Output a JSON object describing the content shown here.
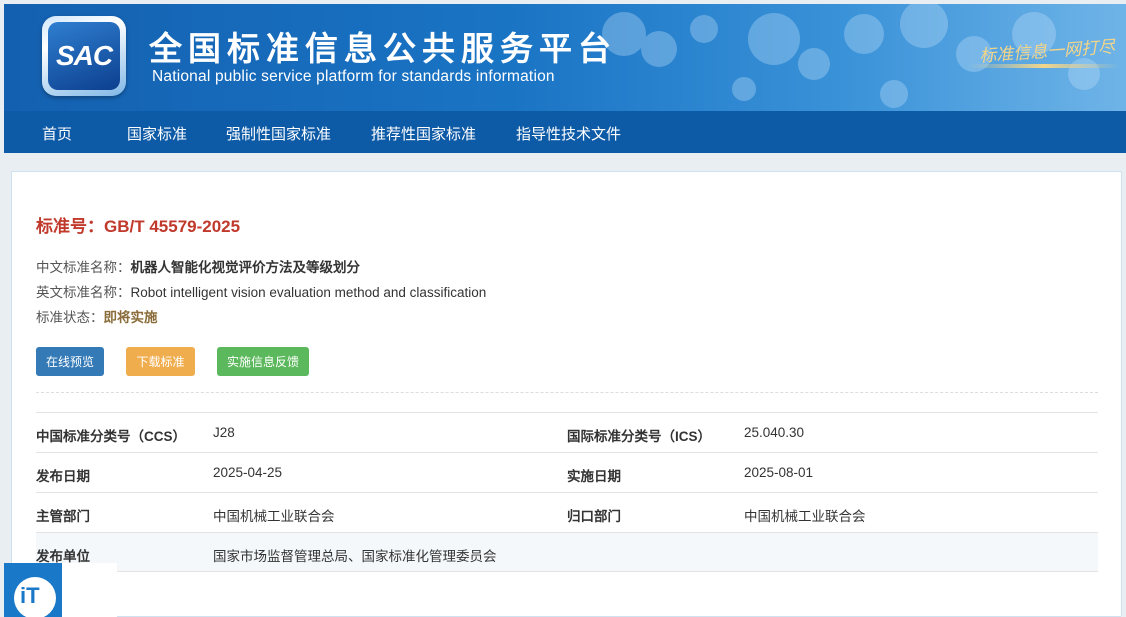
{
  "header": {
    "logo_text": "SAC",
    "title_cn": "全国标准信息公共服务平台",
    "title_en": "National public service platform  for standards information",
    "slogan": "标准信息一网打尽"
  },
  "nav": {
    "items": [
      {
        "label": "首页"
      },
      {
        "label": "国家标准"
      },
      {
        "label": "强制性国家标准"
      },
      {
        "label": "推荐性国家标准"
      },
      {
        "label": "指导性技术文件"
      }
    ]
  },
  "standard": {
    "number_label": "标准号：",
    "number": "GB/T 45579-2025",
    "cn_name_label": "中文标准名称：",
    "cn_name": "机器人智能化视觉评价方法及等级划分",
    "en_name_label": "英文标准名称：",
    "en_name": "Robot intelligent vision evaluation method and classification",
    "status_label": "标准状态：",
    "status": "即将实施"
  },
  "actions": {
    "preview": "在线预览",
    "download": "下载标准",
    "feedback": "实施信息反馈"
  },
  "details": {
    "rows": [
      {
        "k1": "中国标准分类号（CCS）",
        "v1": "J28",
        "k2": "国际标准分类号（ICS）",
        "v2": "25.040.30"
      },
      {
        "k1": "发布日期",
        "v1": "2025-04-25",
        "k2": "实施日期",
        "v2": "2025-08-01"
      },
      {
        "k1": "主管部门",
        "v1": "中国机械工业联合会",
        "k2": "归口部门",
        "v2": "中国机械工业联合会"
      },
      {
        "k1": "发布单位",
        "v1": "国家市场监督管理总局、国家标准化管理委员会",
        "k2": "",
        "v2": ""
      }
    ]
  },
  "watermark": {
    "text": "iT"
  },
  "colors": {
    "header_blue": "#1a74c4",
    "nav_blue": "#0d5aa7",
    "std_red": "#c0392b",
    "btn_blue": "#337ab7",
    "btn_orange": "#f0ad4e",
    "btn_green": "#5cb85c"
  }
}
